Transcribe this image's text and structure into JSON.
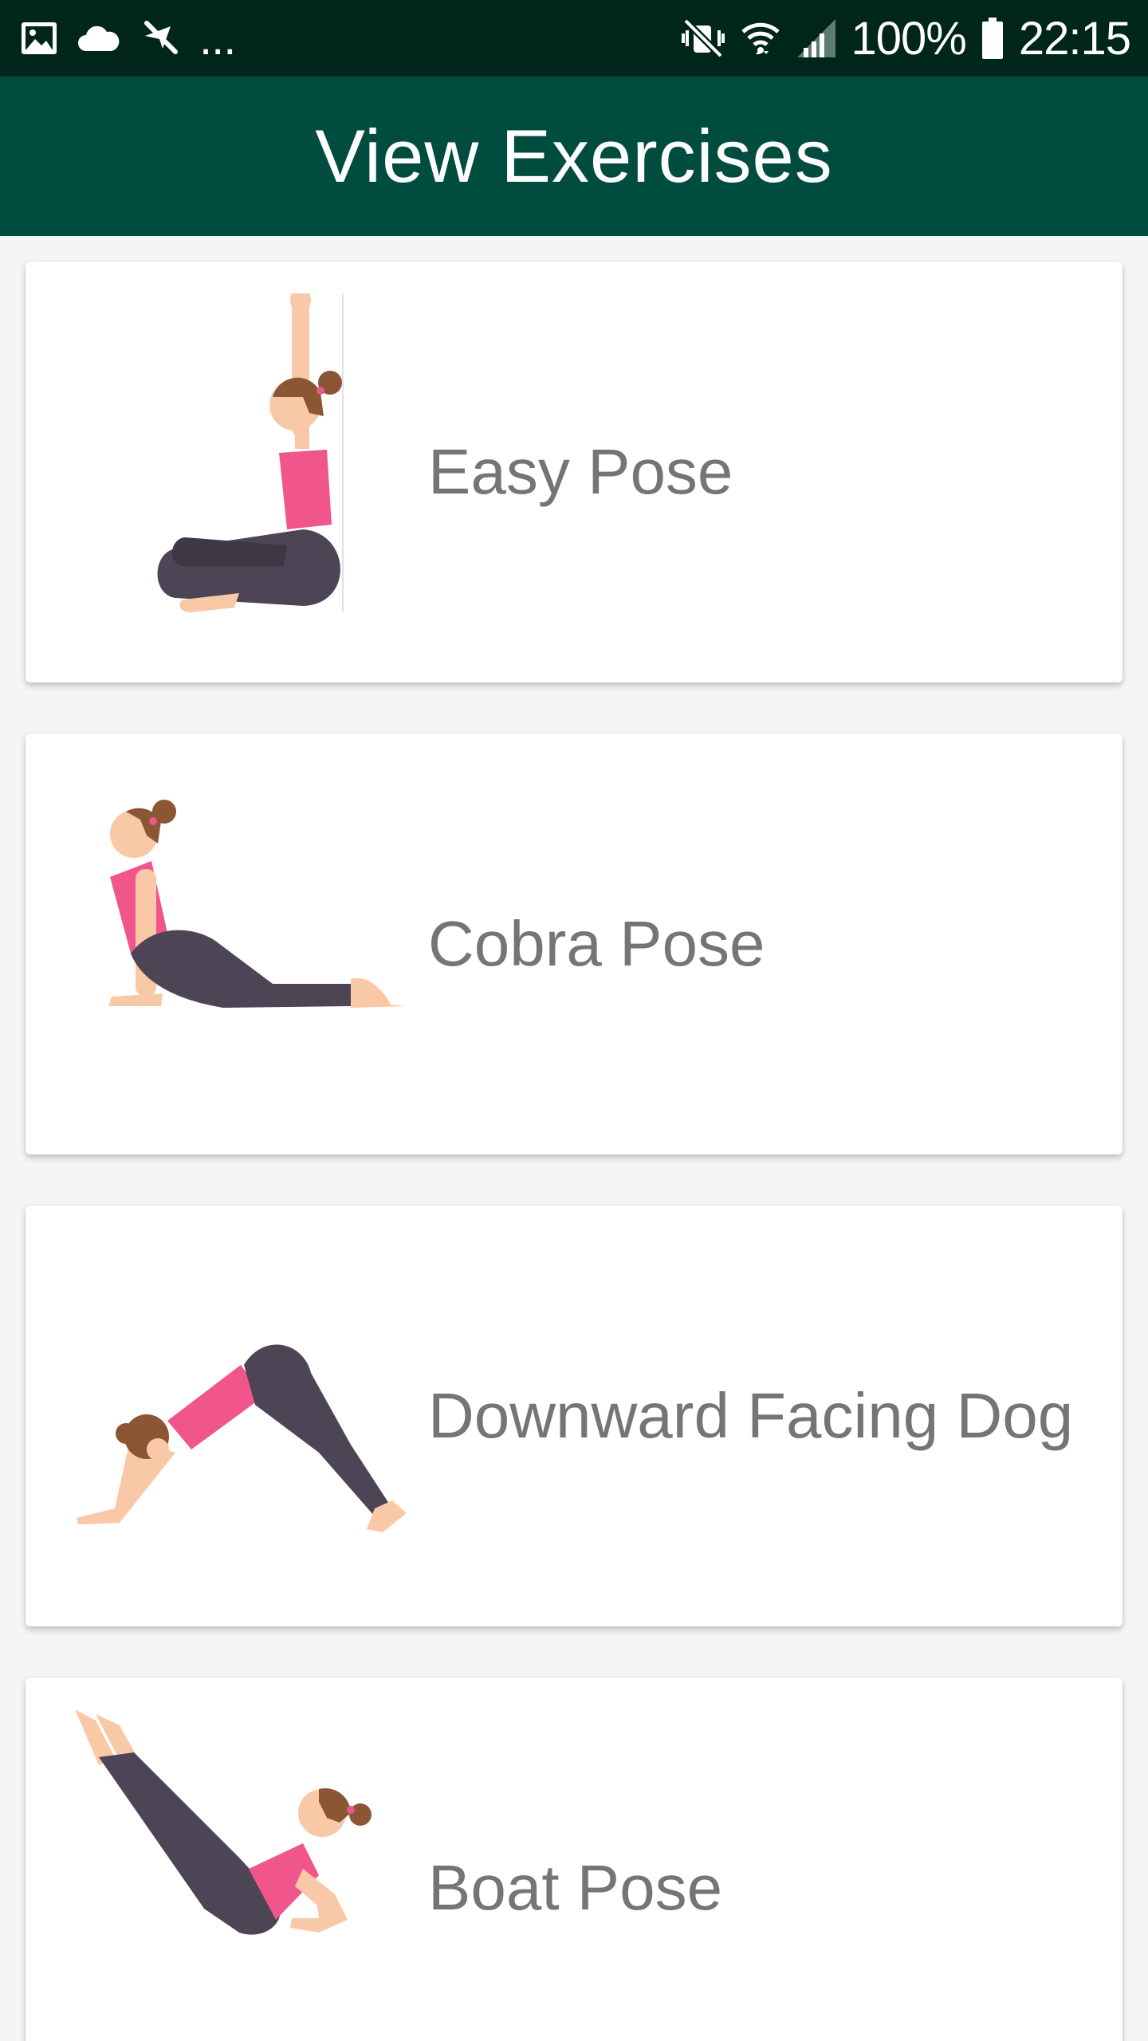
{
  "status_bar": {
    "battery": "100%",
    "time": "22:15",
    "overflow": "...",
    "icons_left": [
      "image-icon",
      "cloud-icon",
      "no-location-icon"
    ],
    "icons_right": [
      "mute-vibrate-icon",
      "wifi-icon",
      "signal-icon",
      "battery-icon"
    ]
  },
  "app_bar": {
    "title": "View Exercises"
  },
  "exercises": [
    {
      "label": "Easy Pose",
      "icon": "easy-pose-illustration"
    },
    {
      "label": "Cobra Pose",
      "icon": "cobra-pose-illustration"
    },
    {
      "label": "Downward Facing Dog",
      "icon": "downward-dog-illustration"
    },
    {
      "label": "Boat Pose",
      "icon": "boat-pose-illustration"
    }
  ],
  "colors": {
    "status_bar": "#00251a",
    "app_bar": "#004d40",
    "label": "#757575",
    "top": "#f0568b",
    "pants": "#4d4556",
    "skin": "#f9c8a6",
    "hair": "#8a5634",
    "background": "#f5f5f5"
  }
}
